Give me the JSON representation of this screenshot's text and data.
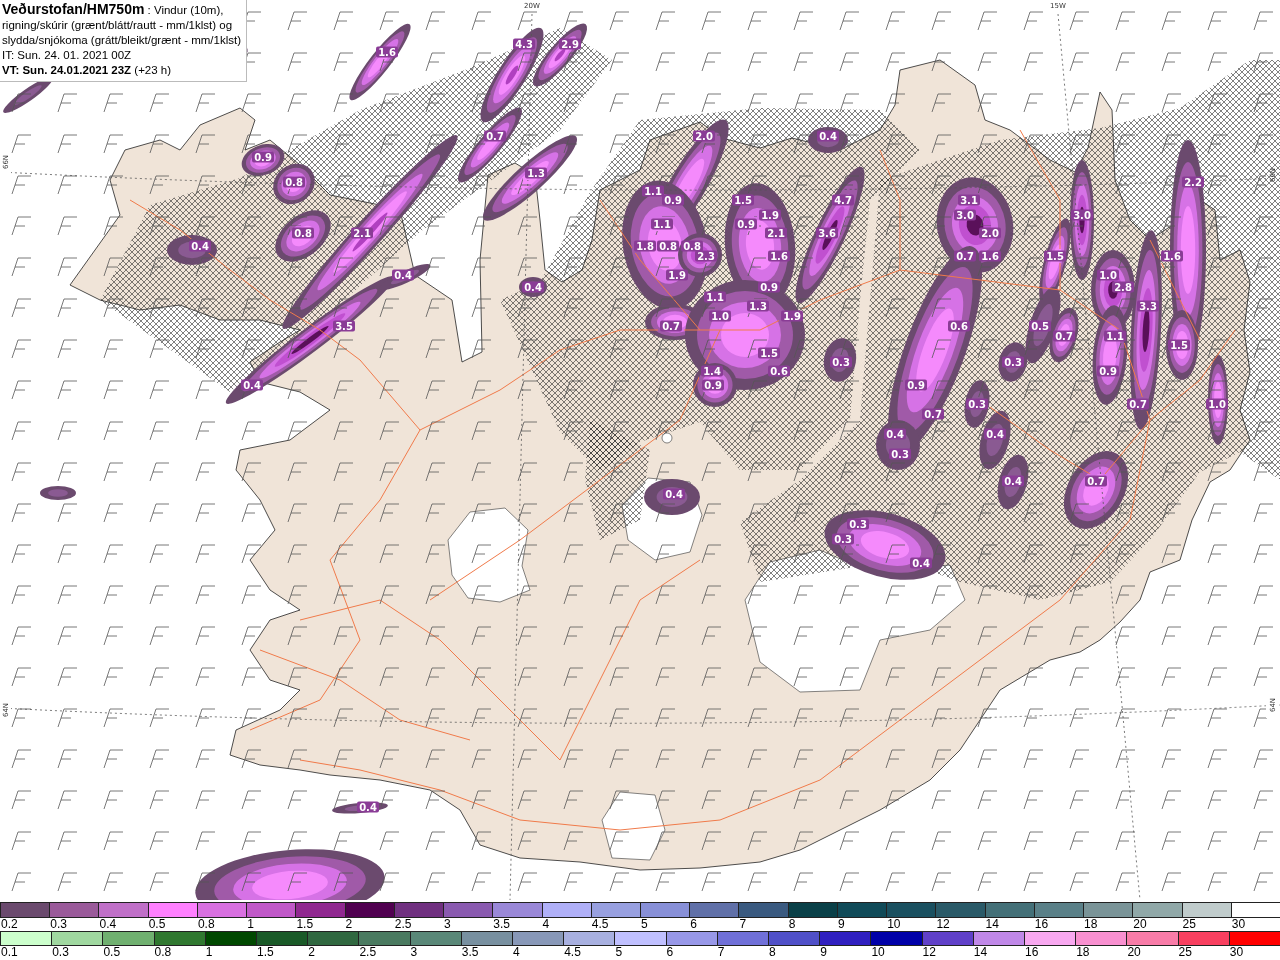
{
  "title_box": {
    "description_lines": [
      "**Veðurstofan/HM750m** : Vindur (10m),",
      "rigning/skúrir (grænt/blátt/rautt - mm/1klst) og",
      "slydda/snjókoma (grátt/bleikt/grænt - mm/1klst)"
    ],
    "init_time": "IT: Sun. 24. 01. 2021 00Z",
    "valid_time": "**VT: Sun. 24.01.2021 23Z** (+23 h)"
  },
  "map": {
    "axis_labels": [
      {
        "kind": "top",
        "text": "20W"
      },
      {
        "kind": "top",
        "text": "15W"
      },
      {
        "kind": "left",
        "text": "66N"
      },
      {
        "kind": "left",
        "text": "64N"
      },
      {
        "kind": "right",
        "text": "66N"
      },
      {
        "kind": "right",
        "text": "64N"
      }
    ],
    "precipitation_values": [
      "4.3",
      "2.9",
      "1.6",
      "0.7",
      "2.0",
      "0.4",
      "0.9",
      "1.3",
      "0.8",
      "2.2",
      "1.1",
      "0.9",
      "1.5",
      "4.7",
      "3.1",
      "1.9",
      "3.0",
      "3.0",
      "1.1",
      "0.9",
      "0.8",
      "2.1",
      "2.1",
      "3.6",
      "2.0",
      "0.4",
      "1.8",
      "0.8",
      "0.8",
      "2.3",
      "1.6",
      "0.7",
      "1.6",
      "1.5",
      "1.6",
      "0.4",
      "1.9",
      "1.0",
      "0.4",
      "0.9",
      "2.8",
      "1.1",
      "1.3",
      "3.3",
      "1.0",
      "1.9",
      "3.5",
      "0.7",
      "0.6",
      "0.5",
      "0.7",
      "1.1",
      "1.5",
      "1.5",
      "0.3",
      "0.3",
      "1.4",
      "0.6",
      "0.9",
      "0.4",
      "0.9",
      "0.9",
      "0.3",
      "0.7",
      "1.0",
      "0.7",
      "0.4",
      "0.4",
      "0.3",
      "0.4",
      "0.7",
      "0.4",
      "0.3",
      "0.3",
      "0.4",
      "0.4"
    ]
  },
  "legend": {
    "snow_scale": [
      {
        "label": "0.2",
        "color": "#6b4a6e"
      },
      {
        "label": "0.3",
        "color": "#9a5a9a"
      },
      {
        "label": "0.4",
        "color": "#c070c8"
      },
      {
        "label": "0.5",
        "color": "#ff80ff"
      },
      {
        "label": "0.8",
        "color": "#d870e0"
      },
      {
        "label": "1",
        "color": "#c058c8"
      },
      {
        "label": "1.5",
        "color": "#902890"
      },
      {
        "label": "2",
        "color": "#500050"
      },
      {
        "label": "2.5",
        "color": "#703080"
      },
      {
        "label": "3",
        "color": "#8a5ab0"
      },
      {
        "label": "3.5",
        "color": "#9a88d8"
      },
      {
        "label": "4",
        "color": "#b0b0f8"
      },
      {
        "label": "4.5",
        "color": "#98a0e0"
      },
      {
        "label": "5",
        "color": "#8890d8"
      },
      {
        "label": "6",
        "color": "#6070a8"
      },
      {
        "label": "7",
        "color": "#3a5a80"
      },
      {
        "label": "8",
        "color": "#0a4048"
      },
      {
        "label": "9",
        "color": "#104a58"
      },
      {
        "label": "10",
        "color": "#1a5060"
      },
      {
        "label": "12",
        "color": "#2a5a68"
      },
      {
        "label": "14",
        "color": "#447078"
      },
      {
        "label": "16",
        "color": "#5a8088"
      },
      {
        "label": "18",
        "color": "#7a9498"
      },
      {
        "label": "20",
        "color": "#90a8a8"
      },
      {
        "label": "25",
        "color": "#c0cccc"
      },
      {
        "label": "30",
        "color": "#ffffff"
      }
    ],
    "rain_scale": [
      {
        "label": "0.1",
        "color": "#ccffcc"
      },
      {
        "label": "0.3",
        "color": "#a0d8a0"
      },
      {
        "label": "0.5",
        "color": "#70b070"
      },
      {
        "label": "0.8",
        "color": "#307830"
      },
      {
        "label": "1",
        "color": "#004800"
      },
      {
        "label": "1.5",
        "color": "#1a5a28"
      },
      {
        "label": "2",
        "color": "#306840"
      },
      {
        "label": "2.5",
        "color": "#4a7a60"
      },
      {
        "label": "3",
        "color": "#5a8878"
      },
      {
        "label": "3.5",
        "color": "#7890a0"
      },
      {
        "label": "4",
        "color": "#8898b8"
      },
      {
        "label": "4.5",
        "color": "#a8b0e0"
      },
      {
        "label": "5",
        "color": "#c0c0ff"
      },
      {
        "label": "6",
        "color": "#9898e8"
      },
      {
        "label": "7",
        "color": "#7070d8"
      },
      {
        "label": "8",
        "color": "#5050c8"
      },
      {
        "label": "9",
        "color": "#3020c0"
      },
      {
        "label": "10",
        "color": "#0000a8"
      },
      {
        "label": "12",
        "color": "#6040c8"
      },
      {
        "label": "14",
        "color": "#c088e8"
      },
      {
        "label": "16",
        "color": "#f8a8f0"
      },
      {
        "label": "18",
        "color": "#f890d0"
      },
      {
        "label": "20",
        "color": "#f87ca8"
      },
      {
        "label": "25",
        "color": "#f84060"
      },
      {
        "label": "30",
        "color": "#ff0000"
      }
    ]
  }
}
